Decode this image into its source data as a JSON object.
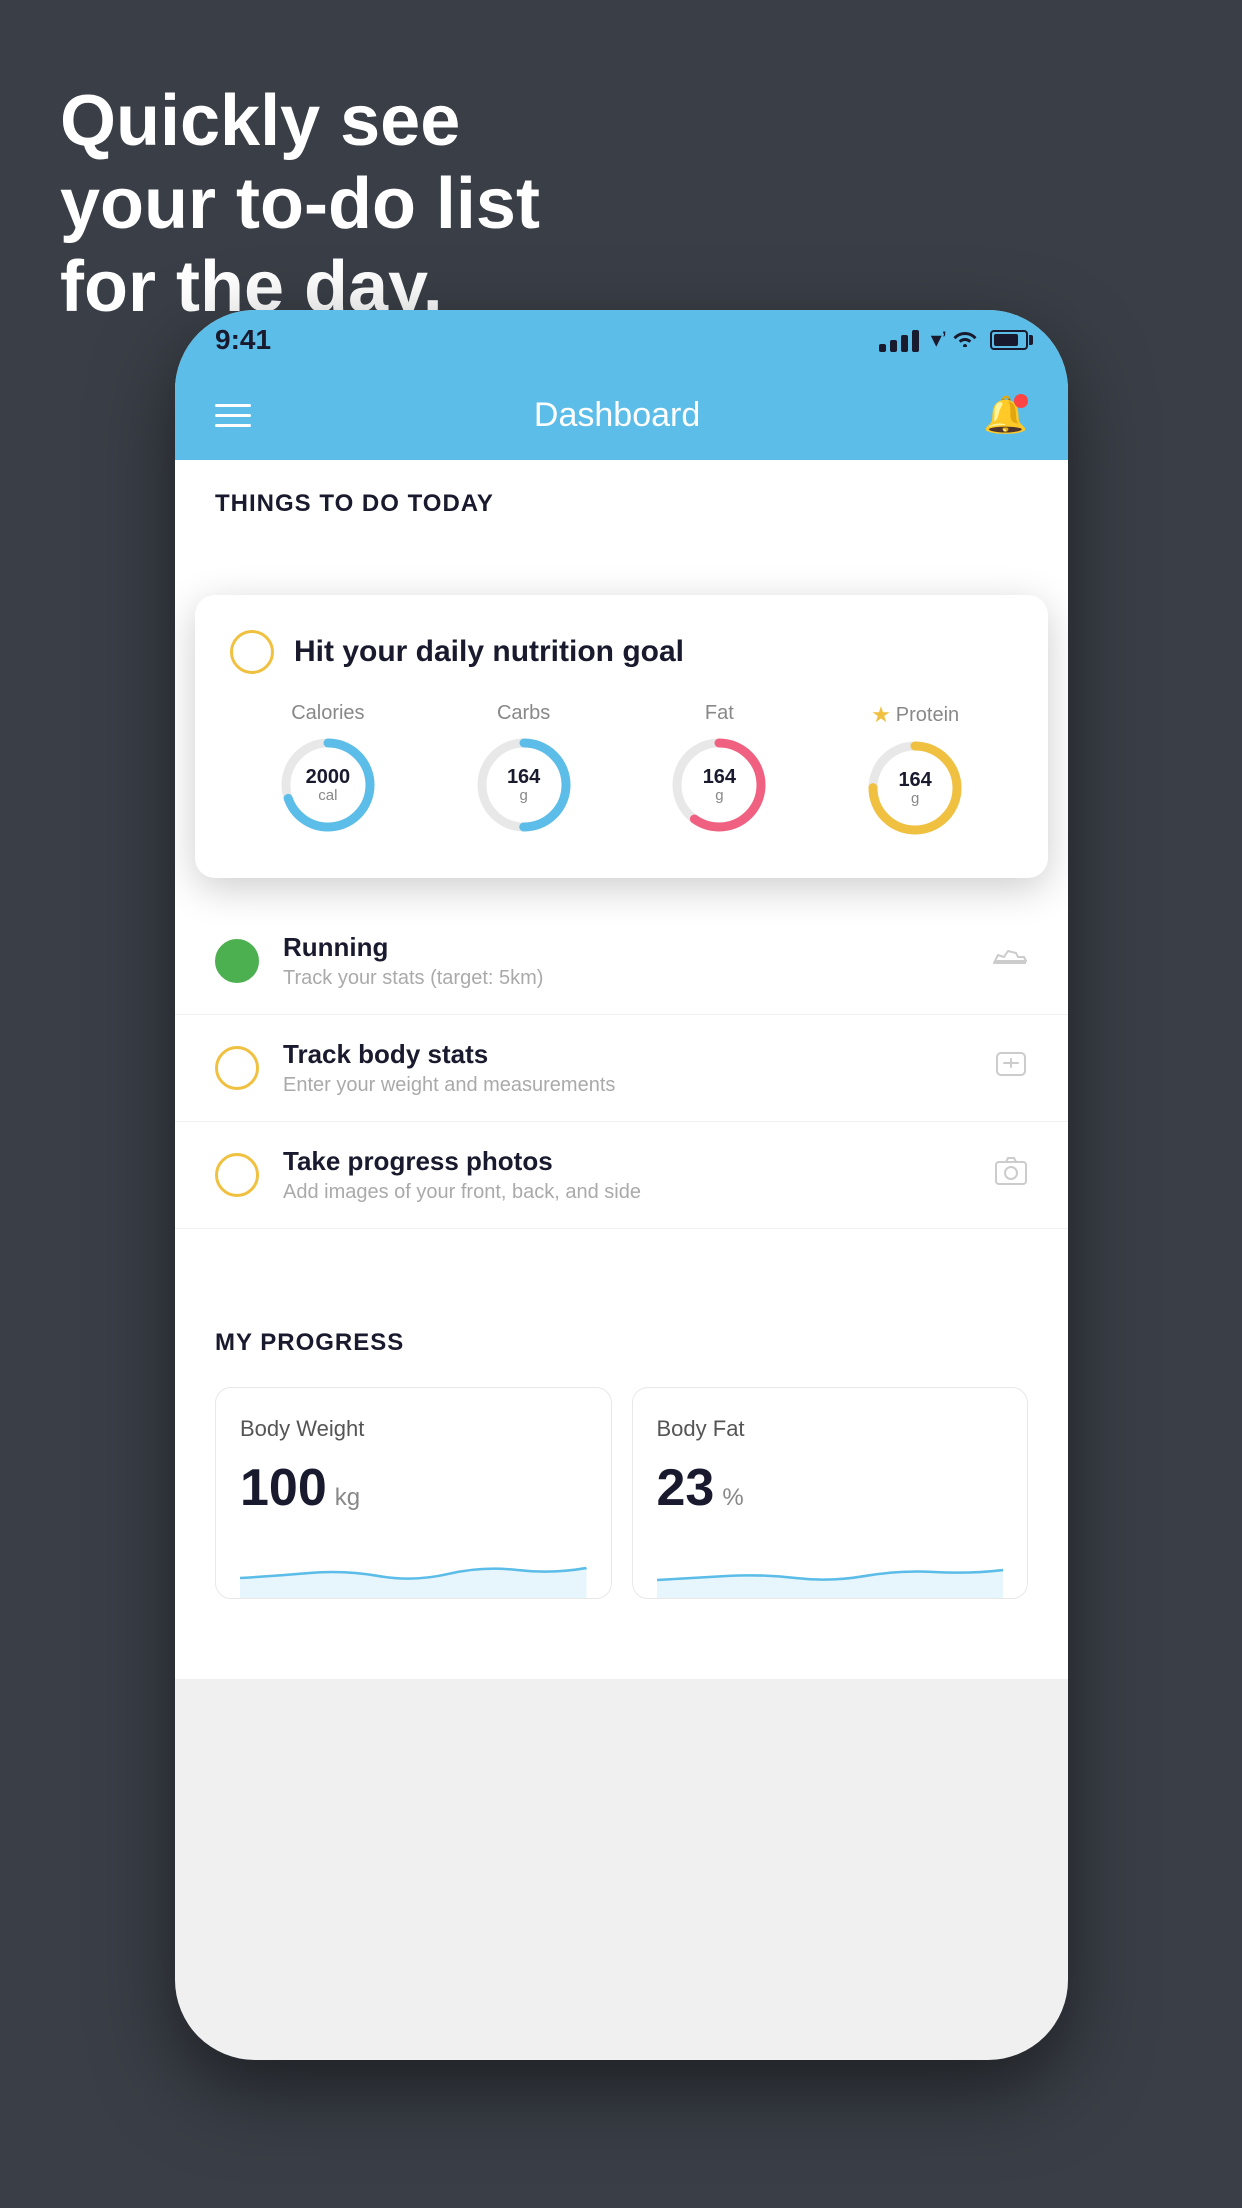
{
  "background": {
    "color": "#3a3f47"
  },
  "headline": {
    "line1": "Quickly see",
    "line2": "your to-do list",
    "line3": "for the day."
  },
  "phone": {
    "status_bar": {
      "time": "9:41"
    },
    "header": {
      "title": "Dashboard",
      "menu_icon": "hamburger-icon",
      "notification_icon": "bell-icon"
    },
    "things_to_do": {
      "section_title": "THINGS TO DO TODAY",
      "featured_task": {
        "title": "Hit your daily nutrition goal",
        "status": "incomplete",
        "stats": [
          {
            "label": "Calories",
            "value": "2000",
            "unit": "cal",
            "color": "#5bbde8",
            "progress": 0.7
          },
          {
            "label": "Carbs",
            "value": "164",
            "unit": "g",
            "color": "#5bbde8",
            "progress": 0.5
          },
          {
            "label": "Fat",
            "value": "164",
            "unit": "g",
            "color": "#f06080",
            "progress": 0.6
          },
          {
            "label": "Protein",
            "value": "164",
            "unit": "g",
            "color": "#f0c040",
            "progress": 0.75,
            "starred": true
          }
        ]
      },
      "todo_items": [
        {
          "title": "Running",
          "subtitle": "Track your stats (target: 5km)",
          "status": "complete",
          "icon": "shoe-icon"
        },
        {
          "title": "Track body stats",
          "subtitle": "Enter your weight and measurements",
          "status": "incomplete",
          "icon": "scale-icon"
        },
        {
          "title": "Take progress photos",
          "subtitle": "Add images of your front, back, and side",
          "status": "incomplete",
          "icon": "photo-icon"
        }
      ]
    },
    "progress": {
      "section_title": "MY PROGRESS",
      "cards": [
        {
          "title": "Body Weight",
          "value": "100",
          "unit": "kg"
        },
        {
          "title": "Body Fat",
          "value": "23",
          "unit": "%"
        }
      ]
    }
  }
}
